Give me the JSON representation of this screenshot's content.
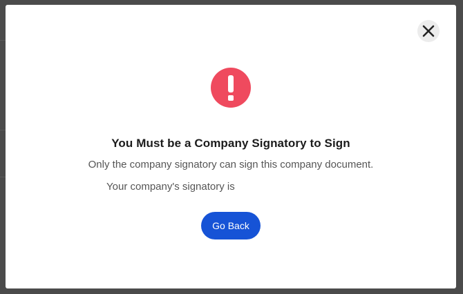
{
  "modal": {
    "title": "You Must be a Company Signatory to Sign",
    "message": "Only the company signatory can sign this company document.",
    "signatory_label": "Your company's signatory is",
    "go_back_label": "Go Back",
    "close_icon": "close-icon",
    "alert_icon": "alert-exclamation-icon",
    "colors": {
      "alert": "#ef4a5e",
      "button": "#1653d6"
    }
  }
}
